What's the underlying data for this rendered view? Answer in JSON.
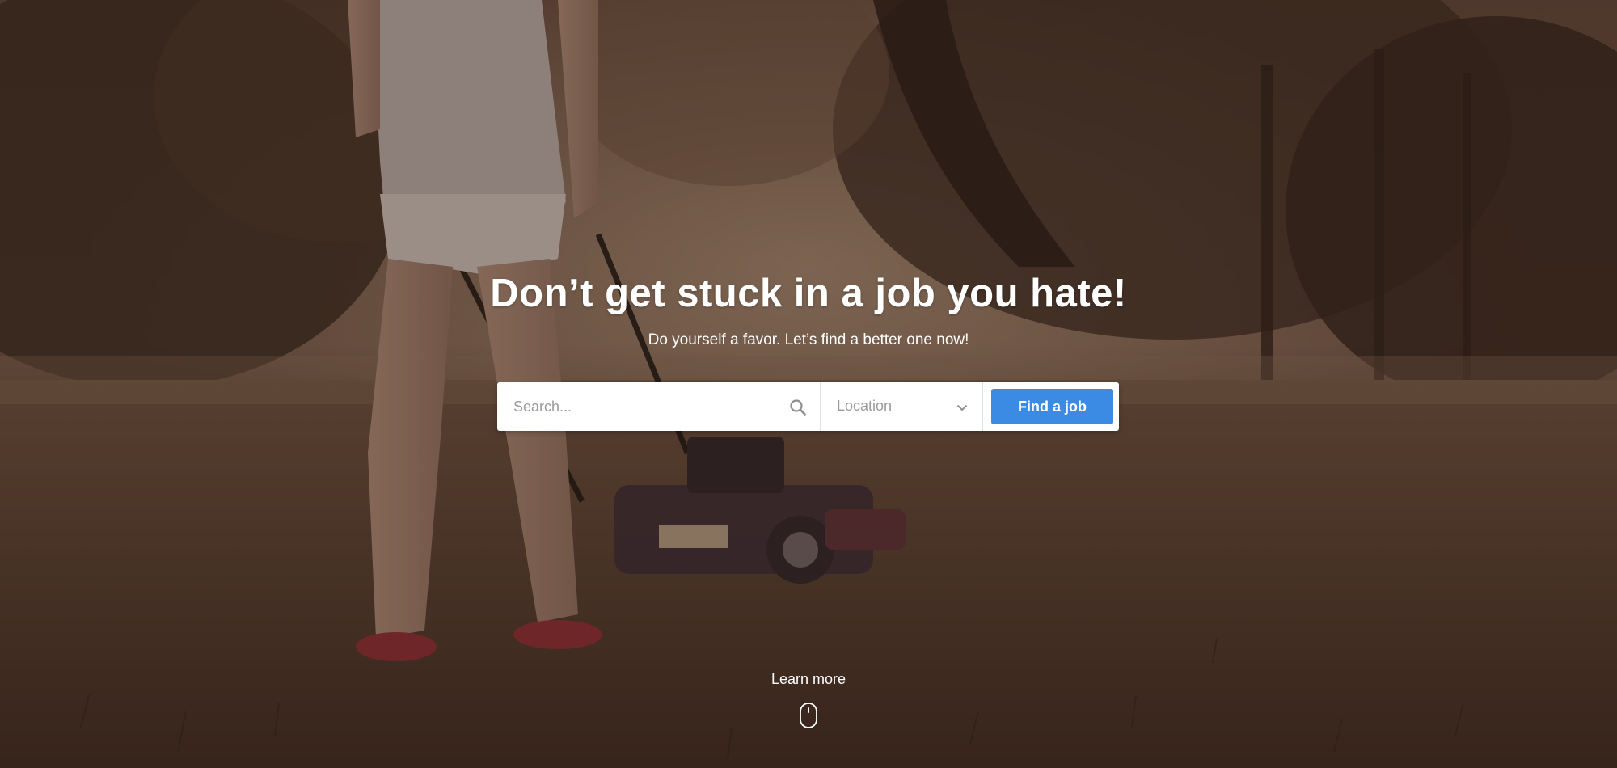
{
  "hero": {
    "headline": "Don’t get stuck in a job you hate!",
    "subheadline": "Do yourself a favor. Let’s find a better one now!"
  },
  "search": {
    "placeholder": "Search...",
    "search_icon": "search-icon",
    "location_label": "Location",
    "location_icon": "chevron-down-icon",
    "button_label": "Find a job"
  },
  "footer_prompt": {
    "label": "Learn more",
    "icon": "mouse-scroll-icon"
  },
  "colors": {
    "accent": "#3b8ae4",
    "text_on_image": "#ffffff",
    "placeholder": "#9a9a9a"
  }
}
